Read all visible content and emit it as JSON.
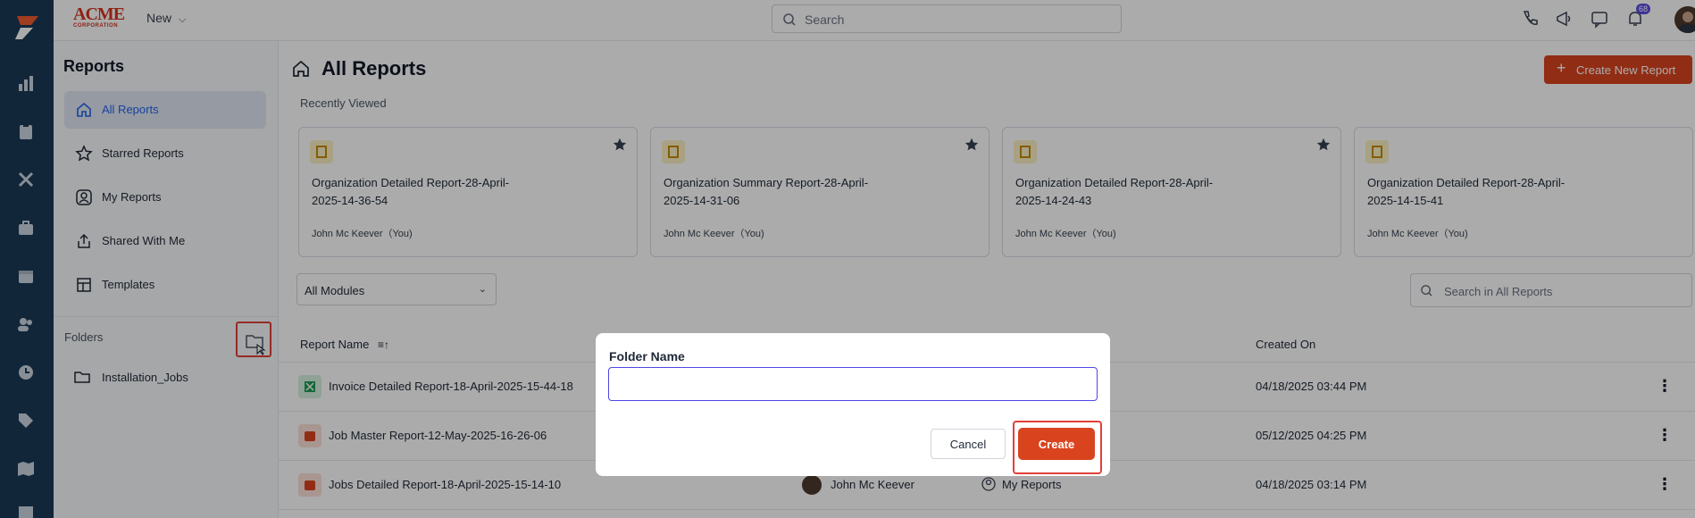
{
  "topbar": {
    "brand_top": "ACME",
    "brand_bottom": "CORPORATION",
    "new_label": "New",
    "search_placeholder": "Search",
    "notification_count": "68"
  },
  "sidebar": {
    "title": "Reports",
    "items": [
      {
        "label": "All Reports"
      },
      {
        "label": "Starred Reports"
      },
      {
        "label": "My Reports"
      },
      {
        "label": "Shared With Me"
      },
      {
        "label": "Templates"
      }
    ],
    "folders_label": "Folders",
    "folders": [
      {
        "label": "Installation_Jobs"
      }
    ]
  },
  "main": {
    "title": "All Reports",
    "create_button": "Create New Report",
    "recently_viewed_label": "Recently Viewed",
    "recent_cards": [
      {
        "name": "Organization Detailed Report-28-April-2025-14-36-54",
        "owner": "John Mc Keever（You)"
      },
      {
        "name": "Organization Summary Report-28-April-2025-14-31-06",
        "owner": "John Mc Keever（You)"
      },
      {
        "name": "Organization Detailed Report-28-April-2025-14-24-43",
        "owner": "John Mc Keever（You)"
      },
      {
        "name": "Organization Detailed Report-28-April-2025-14-15-41",
        "owner": "John Mc Keever（You)"
      }
    ],
    "module_filter": "All Modules",
    "search_placeholder": "Search in All Reports",
    "columns": {
      "report_name": "Report Name",
      "created_on": "Created On"
    },
    "rows": [
      {
        "name": "Invoice Detailed Report-18-April-2025-15-44-18",
        "created_by": "",
        "folder": "",
        "created_on": "04/18/2025 03:44 PM",
        "icon_color": "#d7f0df"
      },
      {
        "name": "Job Master Report-12-May-2025-16-26-06",
        "created_by": "",
        "folder": "",
        "created_on": "05/12/2025 04:25 PM",
        "icon_color": "#fde0d8"
      },
      {
        "name": "Jobs Detailed Report-18-April-2025-15-14-10",
        "created_by": "John Mc Keever",
        "folder": "My Reports",
        "created_on": "04/18/2025 03:14 PM",
        "icon_color": "#fde0d8"
      }
    ]
  },
  "modal": {
    "label": "Folder Name",
    "value": "",
    "cancel_label": "Cancel",
    "create_label": "Create"
  },
  "colors": {
    "accent": "#d9441f",
    "rail": "#1b3a57",
    "focus": "#4f46e5"
  }
}
